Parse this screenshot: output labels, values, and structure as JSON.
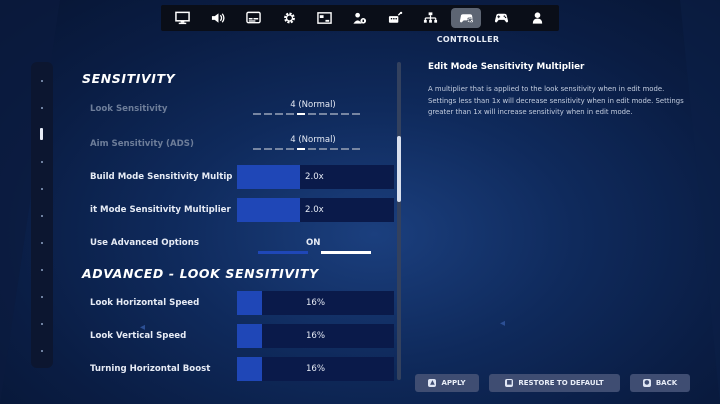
{
  "colors": {
    "accent": "#1f47b7",
    "slider_track": "#0a1a4a",
    "nav_bg": "#0a0e18",
    "button_bg": "#3f4d72"
  },
  "nav": {
    "tabs": [
      {
        "icon": "monitor-icon"
      },
      {
        "icon": "speaker-icon"
      },
      {
        "icon": "subtitles-icon"
      },
      {
        "icon": "gear-icon"
      },
      {
        "icon": "hud-icon"
      },
      {
        "icon": "parental-lock-icon"
      },
      {
        "icon": "input-icon"
      },
      {
        "icon": "network-icon"
      },
      {
        "icon": "controller-settings-icon",
        "active": true
      },
      {
        "icon": "gamepad-icon"
      },
      {
        "icon": "account-icon"
      }
    ],
    "active_caption": "CONTROLLER"
  },
  "sensitivity": {
    "title": "SENSITIVITY",
    "look_sensitivity": {
      "label": "Look Sensitivity",
      "value": "4 (Normal)",
      "step": 4,
      "steps": 10
    },
    "aim_sensitivity": {
      "label": "Aim Sensitivity (ADS)",
      "value": "4 (Normal)",
      "step": 4,
      "steps": 10
    },
    "build_mode": {
      "label": "Build Mode Sensitivity Multip",
      "value": "2.0x",
      "fill": 0.4
    },
    "edit_mode": {
      "label": "it Mode Sensitivity Multiplier",
      "value": "2.0x",
      "fill": 0.4
    },
    "advanced_options": {
      "label": "Use Advanced Options",
      "value": "ON"
    }
  },
  "advanced": {
    "title": "ADVANCED - LOOK SENSITIVITY",
    "horizontal_speed": {
      "label": "Look Horizontal Speed",
      "value": "16%",
      "fill": 0.16
    },
    "vertical_speed": {
      "label": "Look Vertical Speed",
      "value": "16%",
      "fill": 0.16
    },
    "turning_boost": {
      "label": "Turning Horizontal Boost",
      "value": "16%",
      "fill": 0.16
    }
  },
  "description": {
    "title": "Edit Mode Sensitivity Multiplier",
    "body": "A multiplier that is applied to the look sensitivity when in edit mode.  Settings less than 1x will decrease sensitivity when in edit mode.  Settings greater than 1x will increase sensitivity when in edit mode."
  },
  "buttons": {
    "apply": "APPLY",
    "restore": "RESTORE TO DEFAULT",
    "back": "BACK"
  }
}
